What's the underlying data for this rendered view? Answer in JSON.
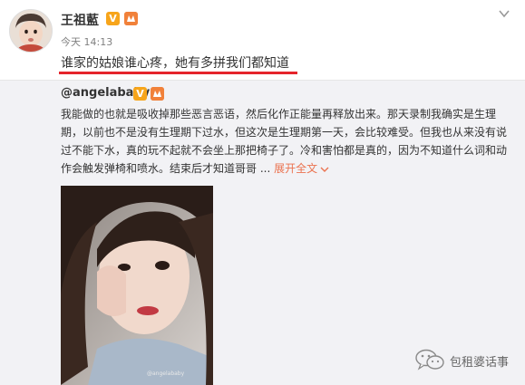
{
  "post": {
    "author": "王祖藍",
    "timestamp": "今天 14:13",
    "text": "谁家的姑娘谁心疼，她有多拼我们都知道",
    "badge_v": "V"
  },
  "repost": {
    "author": "@angelababy",
    "badge_v": "V",
    "text": "我能做的也就是吸收掉那些恶言恶语，然后化作正能量再释放出来。那天录制我确实是生理期，以前也不是没有生理期下过水，但这次是生理期第一天，会比较难受。但我也从来没有说过不能下水，真的玩不起就不会坐上那把椅子了。冷和害怕都是真的，因为不知道什么词和动作会触发弹椅和喷水。结束后才知道哥哥 ... ",
    "expand_label": "展开全文",
    "photo_credit": "@angelababy"
  },
  "watermark": {
    "text": "包租婆话事"
  },
  "colors": {
    "accent_red": "#e5242b",
    "link_orange": "#eb7350",
    "verified_gold": "#f7a51b",
    "repost_bg": "#f2f2f5"
  },
  "icons": {
    "menu": "chevron-down-icon",
    "verified": "verified-v-icon",
    "level": "vip-level-icon",
    "watermark": "wechat-icon"
  }
}
